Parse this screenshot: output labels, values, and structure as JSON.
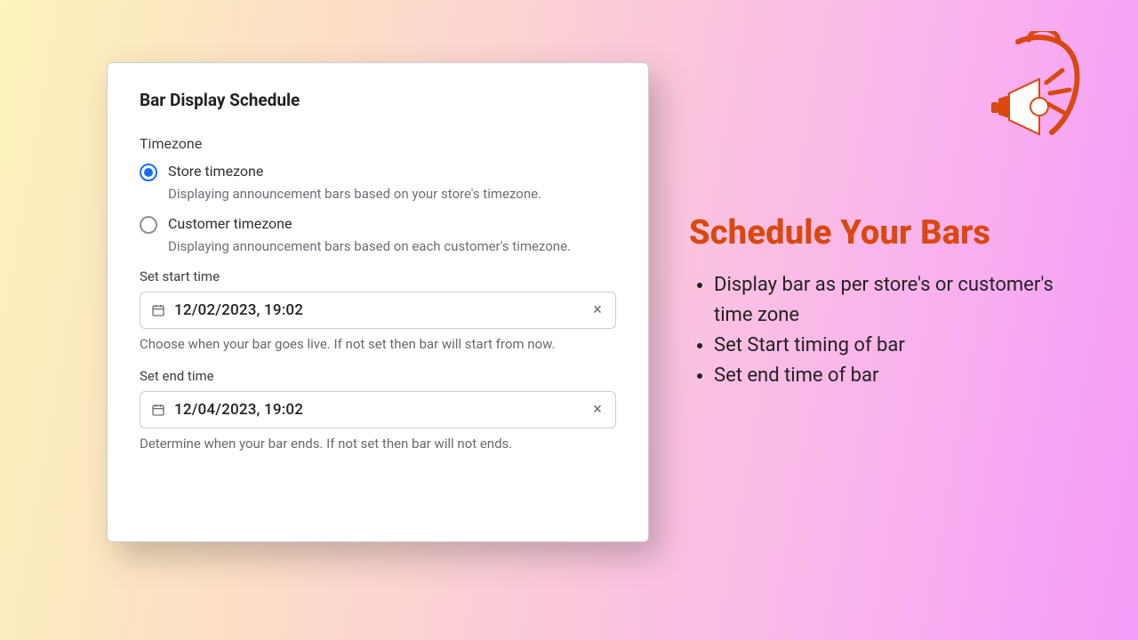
{
  "promo": {
    "heading": "Schedule Your Bars",
    "bullets": [
      "Display bar as per store's or customer's time zone",
      "Set Start timing of bar",
      "Set end time of bar"
    ]
  },
  "card": {
    "title": "Bar Display Schedule",
    "timezone": {
      "label": "Timezone",
      "options": [
        {
          "label": "Store timezone",
          "desc": "Displaying announcement bars based on your store's timezone.",
          "selected": true
        },
        {
          "label": "Customer timezone",
          "desc": "Displaying announcement bars based on each customer's timezone.",
          "selected": false
        }
      ]
    },
    "start": {
      "label": "Set start time",
      "value": "12/02/2023, 19:02",
      "help": "Choose when your bar goes live. If not set then bar will start from now."
    },
    "end": {
      "label": "Set end time",
      "value": "12/04/2023, 19:02",
      "help": "Determine when your bar ends. If not set then bar will not ends."
    }
  }
}
